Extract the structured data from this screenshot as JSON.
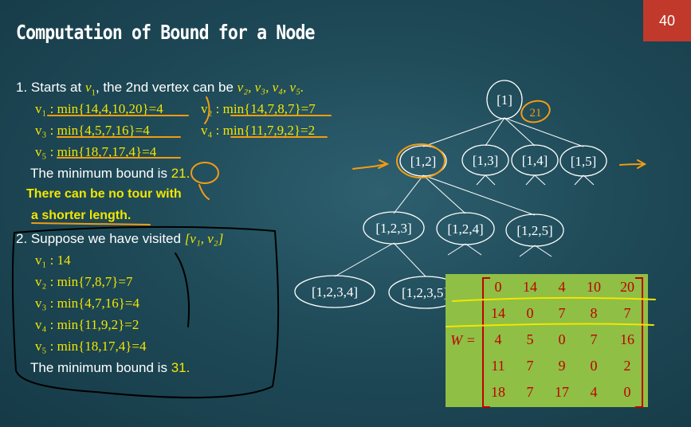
{
  "page_number": "40",
  "title": "Computation of Bound for a  Node",
  "section1": {
    "intro_prefix": "1. Starts at ",
    "intro_v1": "v",
    "intro_v1_sub": "1",
    "intro_mid": ", the 2nd vertex can be ",
    "intro_list": "v₂, v₃, v₄, v₅.",
    "row1_left": "v₁ : min{14,4,10,20}=4",
    "row1_right": "v₂ : min{14,7,8,7}=7",
    "row2_left": "v₃ : min{4,5,7,16}=4",
    "row2_right": "v₄ : min{11,7,9,2}=2",
    "row3_left": "v₅ : min{18,7,17,4}=4",
    "min_bound_text": "The minimum bound is ",
    "min_bound_value": "21.",
    "note_line1": "There can be no tour with",
    "note_line2": "a shorter length."
  },
  "section2": {
    "intro_text": "2. Suppose we have visited ",
    "intro_set": "[v₁, v₂]",
    "rows": [
      "v₁ : 14",
      "v₂ : min{7,8,7}=7",
      "v₃ : min{4,7,16}=4",
      "v₄ : min{11,9,2}=2",
      "v₅ : min{18,17,4}=4"
    ],
    "min_bound_text": "The minimum bound is ",
    "min_bound_value": "31."
  },
  "tree": {
    "root": "[1]",
    "level1": [
      "[1,2]",
      "[1,3]",
      "[1,4]",
      "[1,5]"
    ],
    "level2": [
      "[1,2,3]",
      "[1,2,4]",
      "[1,2,5]"
    ],
    "level3": [
      "[1,2,3,4]",
      "[1,2,3,5]"
    ],
    "root_annotation": "21"
  },
  "matrix": {
    "label": "W =",
    "rows": [
      [
        "0",
        "14",
        "4",
        "10",
        "20"
      ],
      [
        "14",
        "0",
        "7",
        "8",
        "7"
      ],
      [
        "4",
        "5",
        "0",
        "7",
        "16"
      ],
      [
        "11",
        "7",
        "9",
        "0",
        "2"
      ],
      [
        "18",
        "7",
        "17",
        "4",
        "0"
      ]
    ]
  },
  "colors": {
    "background": "#1f4a58",
    "accent_yellow": "#f2e600",
    "page_badge": "#c0392b",
    "matrix_bg": "#8fbf45",
    "matrix_text": "#c00000",
    "ink_orange": "#f39c12"
  }
}
